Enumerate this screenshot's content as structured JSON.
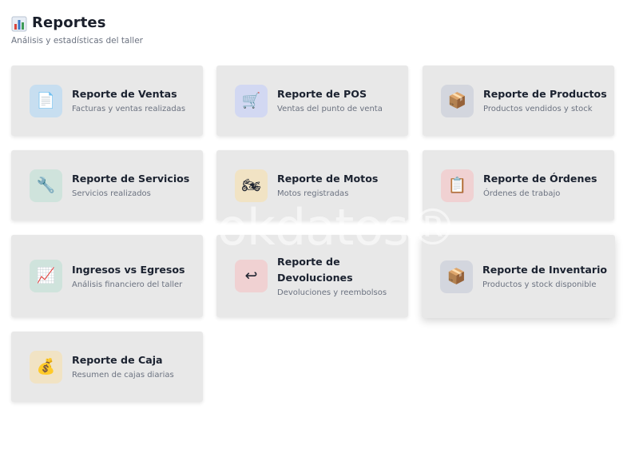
{
  "header": {
    "title_icon": "bar-chart-icon",
    "title": "Reportes",
    "subtitle": "Análisis y estadísticas del taller"
  },
  "cards": [
    {
      "title": "Reporte de Ventas",
      "desc": "Facturas y ventas realizadas",
      "icon": "document-icon",
      "glyph": "📄",
      "icon_bg": "#c7def0"
    },
    {
      "title": "Reporte de POS",
      "desc": "Ventas del punto de venta",
      "icon": "shopping-cart-icon",
      "glyph": "🛒",
      "icon_bg": "#d2d8f2"
    },
    {
      "title": "Reporte de Productos",
      "desc": "Productos vendidos y stock",
      "icon": "package-icon",
      "glyph": "📦",
      "icon_bg": "#d3d6de"
    },
    {
      "title": "Reporte de Servicios",
      "desc": "Servicios realizados",
      "icon": "wrench-icon",
      "glyph": "🔧",
      "icon_bg": "#cfe3dc"
    },
    {
      "title": "Reporte de Motos",
      "desc": "Motos registradas",
      "icon": "motorcycle-icon",
      "glyph": "🏍",
      "icon_bg": "#f1e3c4"
    },
    {
      "title": "Reporte de Órdenes",
      "desc": "Órdenes de trabajo",
      "icon": "clipboard-icon",
      "glyph": "📋",
      "icon_bg": "#f0d1d2"
    },
    {
      "title": "Ingresos vs Egresos",
      "desc": "Análisis financiero del taller",
      "icon": "trend-chart-icon",
      "glyph": "📈",
      "icon_bg": "#cfe3dc"
    },
    {
      "title": "Reporte de Devoluciones",
      "desc": "Devoluciones y reembolsos",
      "icon": "return-arrow-icon",
      "glyph": "↩",
      "icon_bg": "#f0d1d2"
    },
    {
      "title": "Reporte de Inventario",
      "desc": "Productos y stock disponible",
      "icon": "package-icon",
      "glyph": "📦",
      "icon_bg": "#d3d6de"
    },
    {
      "title": "Reporte de Caja",
      "desc": "Resumen de cajas diarias",
      "icon": "money-bag-icon",
      "glyph": "💰",
      "icon_bg": "#f1e3c4"
    }
  ],
  "watermark": "okdatos®"
}
